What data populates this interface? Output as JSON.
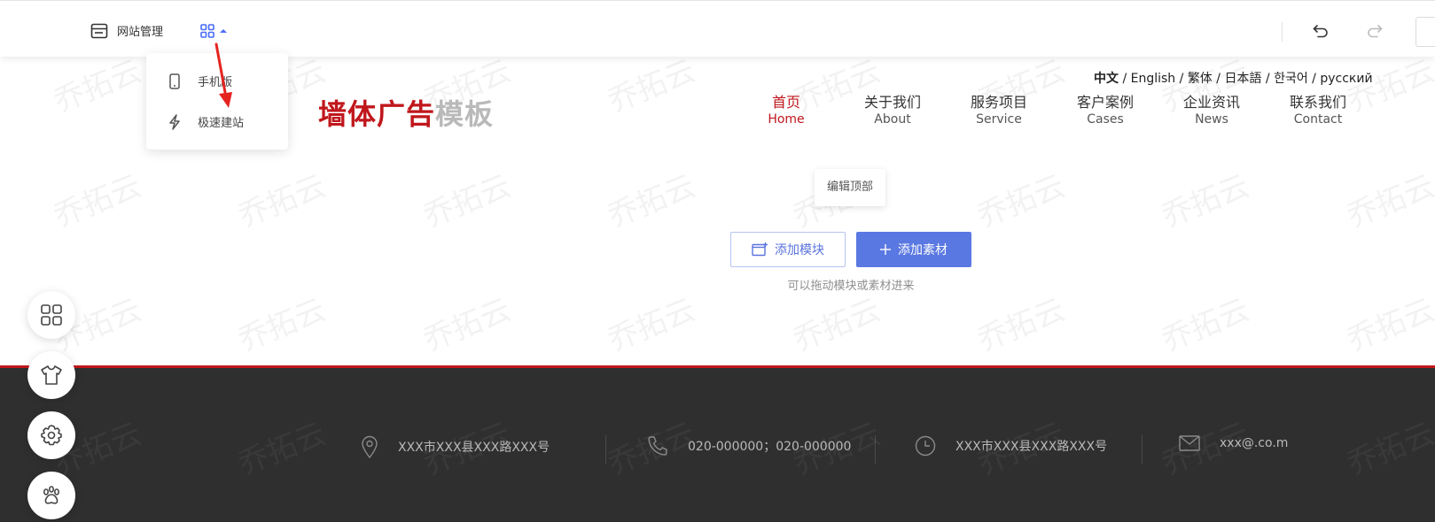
{
  "toolbar": {
    "site_manage_label": "网站管理"
  },
  "dropdown": {
    "items": [
      {
        "label": "手机版",
        "icon": "mobile-icon"
      },
      {
        "label": "极速建站",
        "icon": "lightning-icon"
      }
    ]
  },
  "site": {
    "languages": [
      "中文",
      "English",
      "繁体",
      "日本語",
      "한국어",
      "русский"
    ],
    "language_separator": " / ",
    "logo_part1": "墙体广告",
    "logo_part2": "模板",
    "nav": [
      {
        "cn": "首页",
        "en": "Home",
        "active": true
      },
      {
        "cn": "关于我们",
        "en": "About"
      },
      {
        "cn": "服务项目",
        "en": "Service"
      },
      {
        "cn": "客户案例",
        "en": "Cases"
      },
      {
        "cn": "企业资讯",
        "en": "News"
      },
      {
        "cn": "联系我们",
        "en": "Contact"
      }
    ]
  },
  "editor": {
    "edit_header_label": "编辑顶部",
    "add_module_label": "添加模块",
    "add_material_label": "添加素材",
    "drag_hint": "可以拖动模块或素材进来"
  },
  "footer": {
    "address": "XXX市XXX县XXX路XXX号",
    "phone": "020-000000；020-000000",
    "hours": "XXX市XXX县XXX路XXX号",
    "email": "xxx@.co.m"
  },
  "watermark": "乔拓云",
  "colors": {
    "brand_red": "#c0171c",
    "primary_blue": "#5a78e2",
    "footer_bg": "#2f2f2f"
  }
}
